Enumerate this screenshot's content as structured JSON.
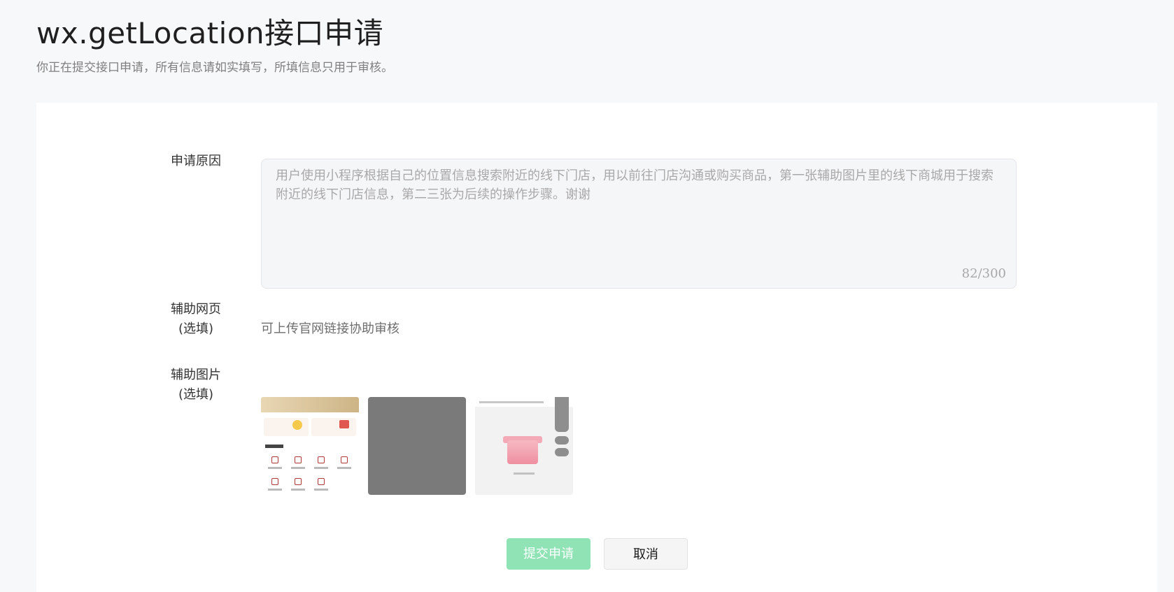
{
  "header": {
    "title": "wx.getLocation接口申请",
    "subtitle": "你正在提交接口申请，所有信息请如实填写，所填信息只用于审核。"
  },
  "form": {
    "reason_label": "申请原因",
    "reason_value": "用户使用小程序根据自己的位置信息搜索附近的线下门店，用以前往门店沟通或购买商品，第一张辅助图片里的线下商城用于搜索附近的线下门店信息，第二三张为后续的操作步骤。谢谢",
    "reason_counter": "82/300",
    "webpage_label_line1": "辅助网页",
    "webpage_label_line2": "(选填)",
    "webpage_hint": "可上传官网链接协助审核",
    "images_label_line1": "辅助图片",
    "images_label_line2": "(选填)",
    "images_count": 3
  },
  "actions": {
    "submit_label": "提交申请",
    "cancel_label": "取消"
  },
  "colors": {
    "submit_bg": "#8fe3b4",
    "page_bg": "#f7f8fa",
    "card_bg": "#ffffff"
  }
}
